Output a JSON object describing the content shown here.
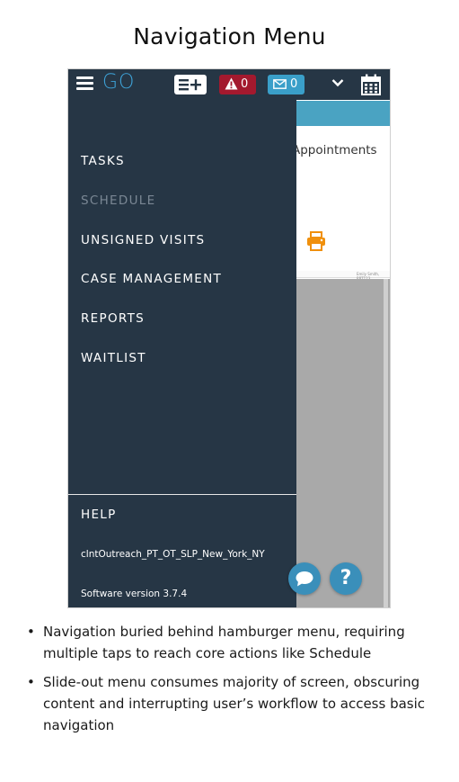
{
  "page_title": "Navigation Menu",
  "app": {
    "logo_text": "GO",
    "alert_count": "0",
    "mail_count": "0",
    "background_heading": "Appointments",
    "strip_text": "Emily Smith, RPT123"
  },
  "menu": {
    "items": [
      {
        "label": "TASKS",
        "disabled": false
      },
      {
        "label": "SCHEDULE",
        "disabled": true
      },
      {
        "label": "UNSIGNED VISITS",
        "disabled": false
      },
      {
        "label": "CASE MANAGEMENT",
        "disabled": false
      },
      {
        "label": "REPORTS",
        "disabled": false
      },
      {
        "label": "WAITLIST",
        "disabled": false
      }
    ],
    "help_label": "HELP",
    "account_name": "clntOutreach_PT_OT_SLP_New_York_NY",
    "version_text": "Software version 3.7.4"
  },
  "fab": {
    "help_glyph": "?"
  },
  "notes": [
    "Navigation buried behind hamburger menu, requiring multiple taps to reach core actions like Schedule",
    "Slide-out menu consumes majority of screen, obscuring content and interrupting user’s workflow to access basic navigation"
  ],
  "colors": {
    "drawer_bg": "#263645",
    "logo": "#3ea3d8",
    "alert": "#a3192e",
    "mail": "#3a9fc9",
    "print_icon": "#f0900d"
  },
  "icons": {
    "menu": "hamburger-icon",
    "add": "add-list-icon",
    "alert": "warning-icon",
    "mail": "envelope-icon",
    "dropdown": "chevron-down-icon",
    "calendar": "calendar-icon",
    "print": "print-icon",
    "chat": "chat-bubble-icon",
    "help": "question-icon"
  }
}
